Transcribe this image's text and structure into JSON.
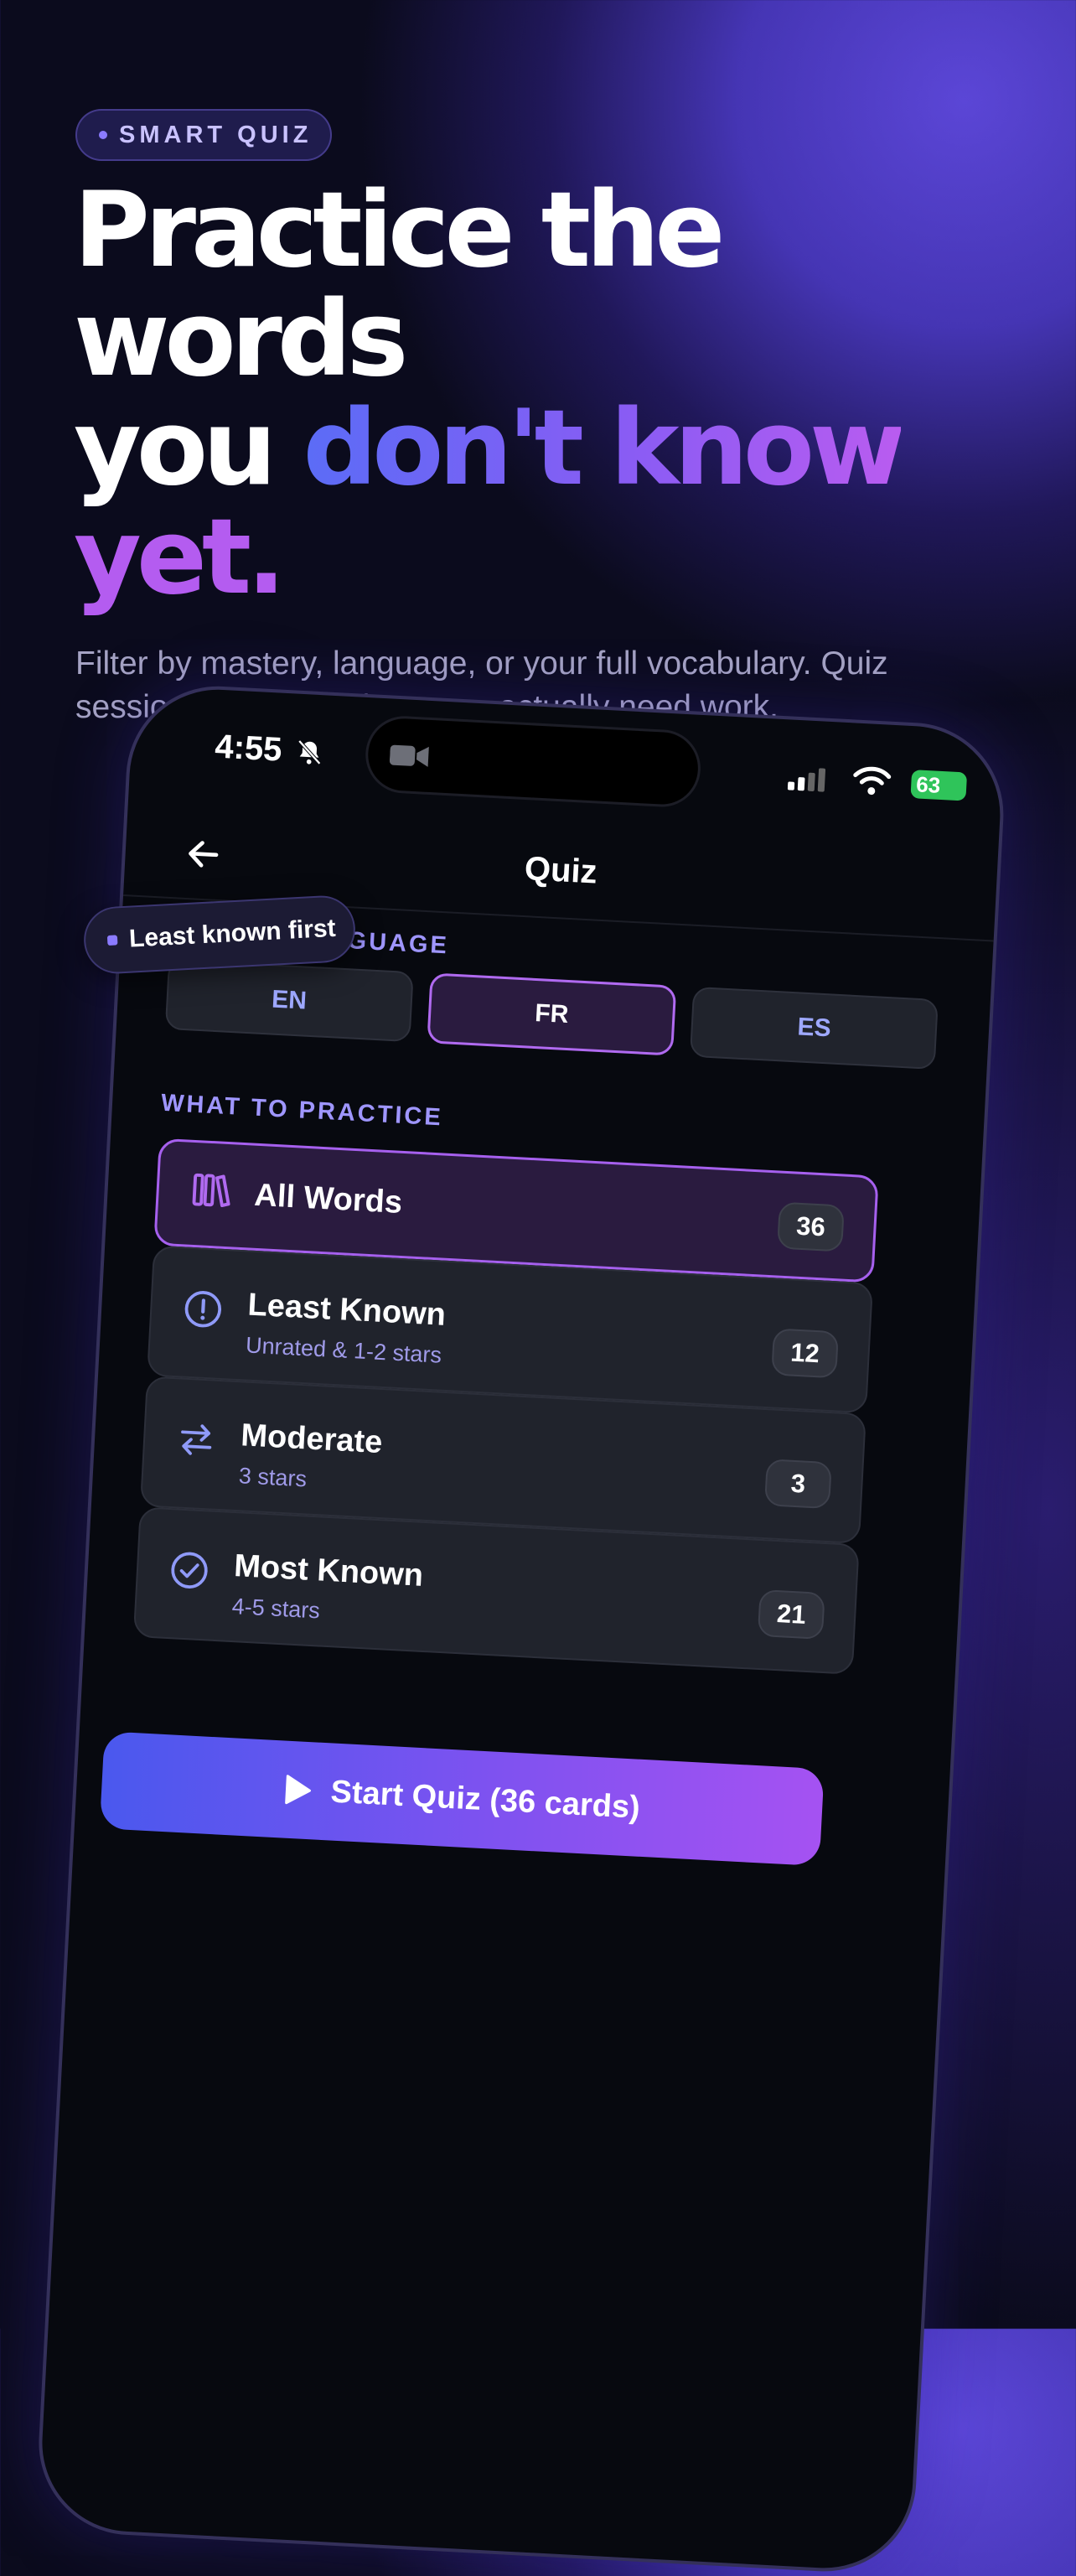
{
  "hero": {
    "chip": "SMART QUIZ",
    "headline_l1": "Practice the",
    "headline_l2": "words",
    "headline_l3a": "you",
    "headline_l3b": "don't know",
    "headline_l4": "yet.",
    "subtitle": "Filter by mastery, language, or your full vocabulary. Quiz sessions adapt to where you actually need work."
  },
  "floating_tag": "Least known first",
  "status_bar": {
    "time": "4:55",
    "battery": "63"
  },
  "screen": {
    "title": "Quiz",
    "select_language_label": "SELECT LANGUAGE",
    "languages": [
      "EN",
      "FR",
      "ES"
    ],
    "selected_language": "FR",
    "what_to_practice_label": "WHAT TO PRACTICE",
    "options": [
      {
        "title": "All Words",
        "subtitle": "",
        "count": "36",
        "icon": "books-icon"
      },
      {
        "title": "Least Known",
        "subtitle": "Unrated & 1-2 stars",
        "count": "12",
        "icon": "alert-circle-icon"
      },
      {
        "title": "Moderate",
        "subtitle": "3 stars",
        "count": "3",
        "icon": "swap-arrows-icon"
      },
      {
        "title": "Most Known",
        "subtitle": "4-5 stars",
        "count": "21",
        "icon": "check-circle-icon"
      }
    ],
    "start_button": "Start Quiz (36 cards)"
  },
  "colors": {
    "accent_blue": "#5b6cf6",
    "accent_purple": "#b45cf0",
    "background": "#0b0b1d",
    "battery_green": "#2fc45a"
  }
}
